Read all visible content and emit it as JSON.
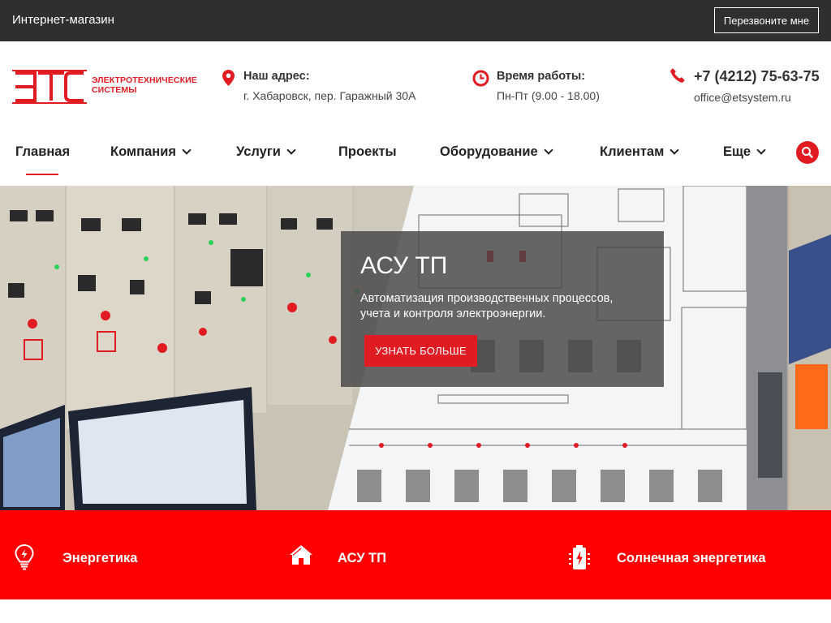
{
  "topbar": {
    "shop_label": "Интернет-магазин",
    "callback_label": "Перезвоните мне"
  },
  "brand": {
    "logo_line1": "ЭЛЕКТРОТЕХНИЧЕСКИЕ",
    "logo_line2": "СИСТЕМЫ",
    "accent_color": "#e11b22"
  },
  "contacts": {
    "address_label": "Наш адрес:",
    "address_value": "г. Хабаровск, пер. Гаражный 30А",
    "hours_label": "Время работы:",
    "hours_value": "Пн-Пт (9.00 - 18.00)",
    "phone": "+7 (4212) 75-63-75",
    "email": "office@etsystem.ru"
  },
  "nav": {
    "items": [
      {
        "label": "Главная",
        "has_dropdown": false,
        "active": true
      },
      {
        "label": "Компания",
        "has_dropdown": true
      },
      {
        "label": "Услуги",
        "has_dropdown": true
      },
      {
        "label": "Проекты",
        "has_dropdown": false
      },
      {
        "label": "Оборудование",
        "has_dropdown": true
      },
      {
        "label": "Клиентам",
        "has_dropdown": true
      },
      {
        "label": "Еще",
        "has_dropdown": true
      }
    ],
    "search_icon": "search-icon"
  },
  "hero": {
    "title": "АСУ ТП",
    "subtitle": "Автоматизация производственных процессов, учета и контроля электроэнергии.",
    "button_label": "УЗНАТЬ БОЛЬШЕ"
  },
  "services": [
    {
      "label": "Энергетика",
      "icon": "lightbulb-icon"
    },
    {
      "label": "АСУ ТП",
      "icon": "home-icon"
    },
    {
      "label": "Солнечная энергетика",
      "icon": "battery-bolt-icon"
    }
  ]
}
